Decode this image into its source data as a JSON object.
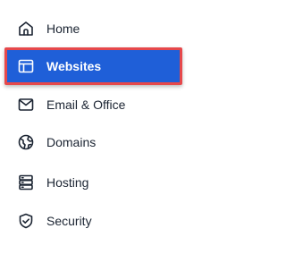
{
  "nav": {
    "items": [
      {
        "label": "Home",
        "icon": "home-icon",
        "active": false
      },
      {
        "label": "Websites",
        "icon": "website-icon",
        "active": true
      },
      {
        "label": "Email & Office",
        "icon": "mail-icon",
        "active": false
      },
      {
        "label": "Domains",
        "icon": "globe-icon",
        "active": false
      },
      {
        "label": "Hosting",
        "icon": "server-icon",
        "active": false
      },
      {
        "label": "Security",
        "icon": "shield-icon",
        "active": false
      }
    ]
  },
  "colors": {
    "active_bg": "#1f5fd8",
    "active_outline": "#e6484b",
    "text": "#1b2432",
    "icon": "#1b2432"
  }
}
